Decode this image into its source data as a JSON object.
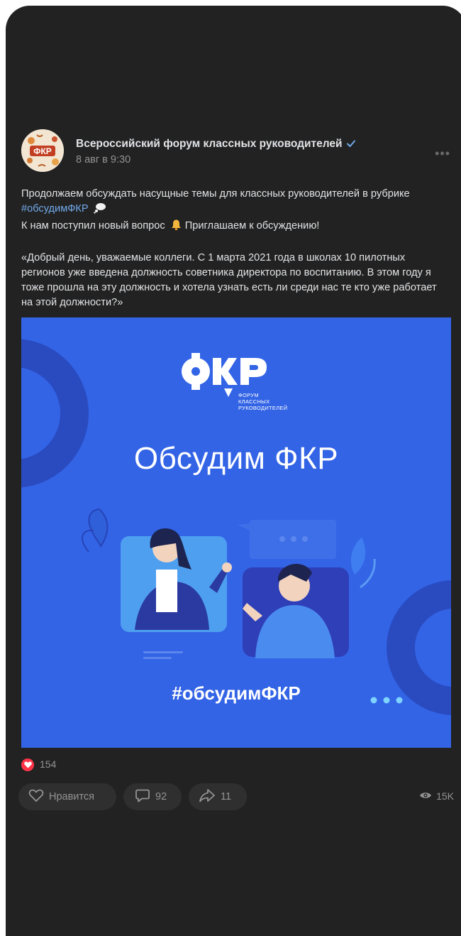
{
  "post": {
    "author": "Всероссийский форум классных руководителей",
    "date": "8 авг в 9:30",
    "more_label": "•••",
    "avatar_text": "ФКР",
    "text_line1": "Продолжаем обсуждать насущные темы для классных руководителей в рубрике ",
    "hashtag": "#обсудимФКР",
    "text_line2": "К нам поступил новый вопрос ",
    "text_line2b": " Приглашаем к обсуждению!",
    "quote": "«Добрый день, уважаемые коллеги. С 1 марта 2021 года в школах 10 пилотных регионов уже введена должность советника директора по воспитанию. В этом году я тоже прошла на эту должность и хотела узнать есть ли среди нас те кто уже работает на этой должности?»"
  },
  "image": {
    "logo": "ФКР",
    "logo_sub1": "ФОРУМ",
    "logo_sub2": "КЛАССНЫХ",
    "logo_sub3": "РУКОВОДИТЕЛЕЙ",
    "title": "Обсудим ФКР",
    "tag": "#обсудимФКР"
  },
  "reactions": {
    "count": "154"
  },
  "actions": {
    "like_label": "Нравится",
    "comments": "92",
    "shares": "11",
    "views": "15K"
  },
  "colors": {
    "background": "#222222",
    "accent_link": "#71aaeb",
    "image_bg": "#3364e6",
    "heart": "#ff3347"
  }
}
